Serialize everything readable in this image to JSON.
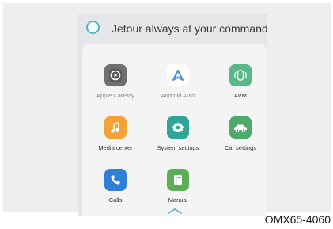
{
  "header": {
    "assistant_text": "Jetour always at your command",
    "icon": "voice-assistant-ring-icon"
  },
  "apps": [
    {
      "label": "Apple CarPlay",
      "icon": "carplay-icon",
      "color": "#6f6f6f",
      "dimmed": true
    },
    {
      "label": "Android Auto",
      "icon": "android-auto-icon",
      "color": "#ffffff",
      "dimmed": true
    },
    {
      "label": "AVM",
      "icon": "avm-camera-icon",
      "color": "#57b88a",
      "dimmed": false
    },
    {
      "label": "Media center",
      "icon": "music-note-icon",
      "color": "#f3a23a",
      "dimmed": false
    },
    {
      "label": "System settings",
      "icon": "gear-icon",
      "color": "#2ea597",
      "dimmed": false
    },
    {
      "label": "Car settings",
      "icon": "car-icon",
      "color": "#4cab6a",
      "dimmed": false
    },
    {
      "label": "Calls",
      "icon": "phone-icon",
      "color": "#2f7fd6",
      "dimmed": false
    },
    {
      "label": "Manual",
      "icon": "book-icon",
      "color": "#5cae54",
      "dimmed": false
    }
  ],
  "collapse": {
    "icon": "chevron-up-icon"
  },
  "footer": {
    "code": "OMX65-4060"
  },
  "colors": {
    "accent": "#58b3c2",
    "panel": "#e4e6e8",
    "card": "#f4f4f4"
  }
}
